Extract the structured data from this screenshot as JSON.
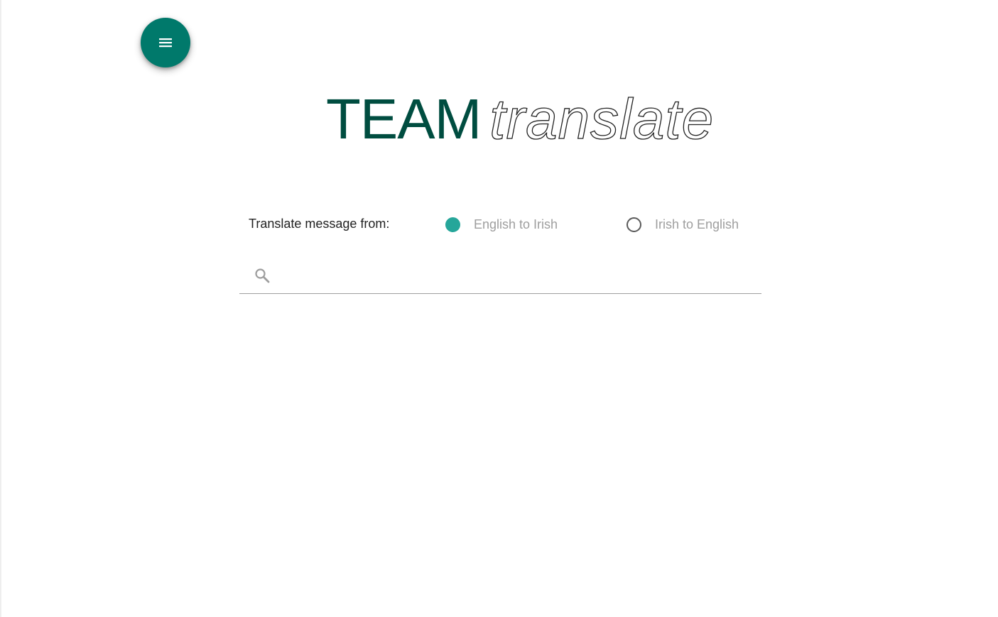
{
  "header": {
    "menu_icon": "menu-icon",
    "menu_button_color": "#00796b"
  },
  "logo": {
    "part1": "TEAM",
    "part2": "translate",
    "part1_color": "#004d40"
  },
  "translate": {
    "label": "Translate message from:",
    "options": [
      {
        "label": "English to Irish",
        "selected": true
      },
      {
        "label": "Irish to English",
        "selected": false
      }
    ],
    "accent_color": "#26a69a"
  },
  "search": {
    "icon": "search-icon",
    "value": "",
    "placeholder": ""
  }
}
